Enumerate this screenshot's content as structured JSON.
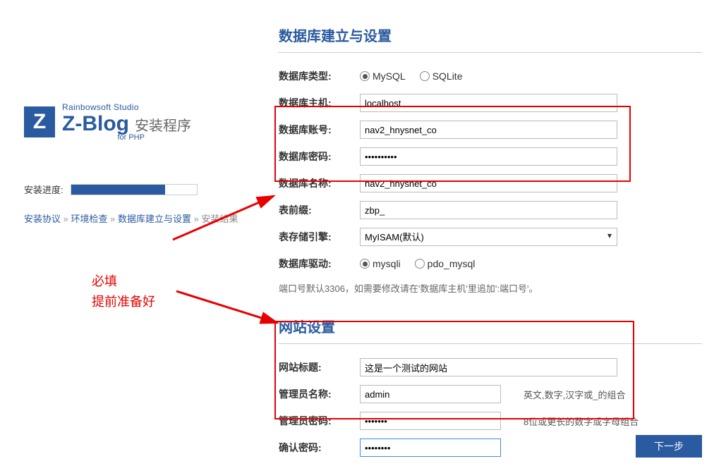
{
  "sidebar": {
    "logo_studio": "Rainbowsoft Studio",
    "logo_main": "Z-Blog",
    "logo_suffix": "安装程序",
    "logo_forphp": "for PHP",
    "progress_label": "安装进度:",
    "breadcrumb": {
      "step1": "安装协议",
      "step2": "环境检查",
      "step3": "数据库建立与设置",
      "step4": "安装结果",
      "sep": "»"
    }
  },
  "annotation": {
    "line1": "必填",
    "line2": "提前准备好"
  },
  "db_section": {
    "title": "数据库建立与设置",
    "type_label": "数据库类型:",
    "type_mysql": "MySQL",
    "type_sqlite": "SQLite",
    "host_label": "数据库主机:",
    "host_value": "localhost",
    "user_label": "数据库账号:",
    "user_value": "nav2_hnysnet_co",
    "pwd_label": "数据库密码:",
    "pwd_value": "••••••••••",
    "name_label": "数据库名称:",
    "name_value": "nav2_hnysnet_co",
    "prefix_label": "表前缀:",
    "prefix_value": "zbp_",
    "engine_label": "表存储引擎:",
    "engine_value": "MyISAM(默认)",
    "driver_label": "数据库驱动:",
    "driver_mysqli": "mysqli",
    "driver_pdo": "pdo_mysql",
    "note": "端口号默认3306，如需要修改请在'数据库主机'里追加':端口号'。"
  },
  "site_section": {
    "title": "网站设置",
    "title_label": "网站标题:",
    "title_value": "这是一个测试的网站",
    "admin_label": "管理员名称:",
    "admin_value": "admin",
    "admin_hint": "英文,数字,汉字或_的组合",
    "pwd_label": "管理员密码:",
    "pwd_value": "•••••••",
    "pwd_hint": "8位或更长的数字或字母组合",
    "pwd2_label": "确认密码:",
    "pwd2_value": "••••••••"
  },
  "next_button": "下一步"
}
